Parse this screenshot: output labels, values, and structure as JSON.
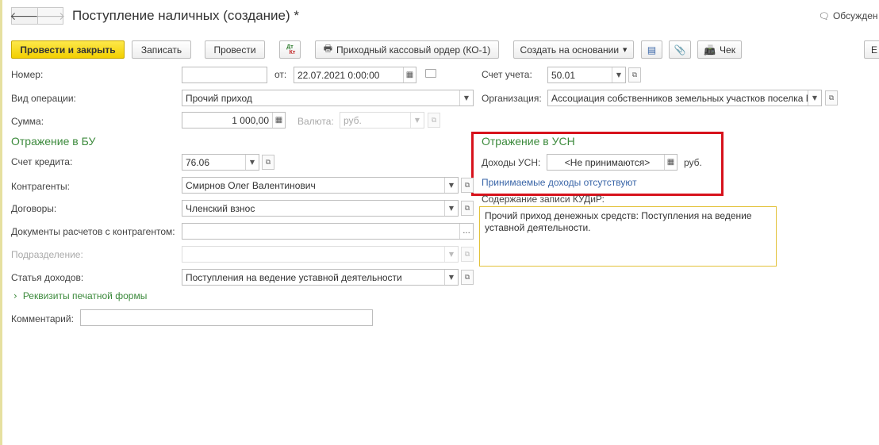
{
  "window": {
    "title": "Поступление наличных (создание) *",
    "discuss_label": "Обсужден",
    "back_icon": "arrow-left-icon",
    "forward_icon": "arrow-right-icon"
  },
  "toolbar": {
    "post_close_label": "Провести и закрыть",
    "save_label": "Записать",
    "post_label": "Провести",
    "dtkt_label": "Дт Кт",
    "print_order_label": "Приходный кассовый ордер (КО-1)",
    "create_based_label": "Создать на основании",
    "receipt_label": "Чек",
    "more_label": "Е"
  },
  "form": {
    "number": {
      "label": "Номер:",
      "value": ""
    },
    "date": {
      "label": "от:",
      "value": "22.07.2021  0:00:00"
    },
    "account": {
      "label": "Счет учета:",
      "value": "50.01"
    },
    "operation_type": {
      "label": "Вид операции:",
      "value": "Прочий приход"
    },
    "organization": {
      "label": "Организация:",
      "value": "Ассоциация собственников земельных участков поселка Е"
    },
    "amount": {
      "label": "Сумма:",
      "value": "1 000,00"
    },
    "currency": {
      "label": "Валюта:",
      "value": "руб."
    }
  },
  "bu_section": {
    "title": "Отражение в БУ",
    "credit_account": {
      "label": "Счет кредита:",
      "value": "76.06"
    },
    "counterparty": {
      "label": "Контрагенты:",
      "value": "Смирнов Олег Валентинович"
    },
    "contract": {
      "label": "Договоры:",
      "value": "Членский взнос"
    },
    "settlement_docs": {
      "label": "Документы расчетов с контрагентом:",
      "value": "",
      "button": "..."
    },
    "department": {
      "label": "Подразделение:",
      "value": ""
    },
    "income_item": {
      "label": "Статья доходов:",
      "value": "Поступления на ведение уставной деятельности"
    },
    "print_details_label": "Реквизиты печатной формы",
    "comment": {
      "label": "Комментарий:",
      "value": ""
    }
  },
  "usn_section": {
    "title": "Отражение в УСН",
    "income": {
      "label": "Доходы УСН:",
      "value": "<Не принимаются>",
      "unit": "руб."
    },
    "accepted_income_link": "Принимаемые доходы отсутствуют",
    "kudir": {
      "label": "Содержание записи КУДиР:",
      "text": "Прочий приход денежных средств: Поступления на ведение уставной деятельности."
    }
  },
  "colors": {
    "accent_green": "#3c8a3c",
    "primary_button": "#f2cf00",
    "highlight_red": "#d7121c",
    "memo_border": "#e3c23a",
    "link_blue": "#3a66a8"
  }
}
